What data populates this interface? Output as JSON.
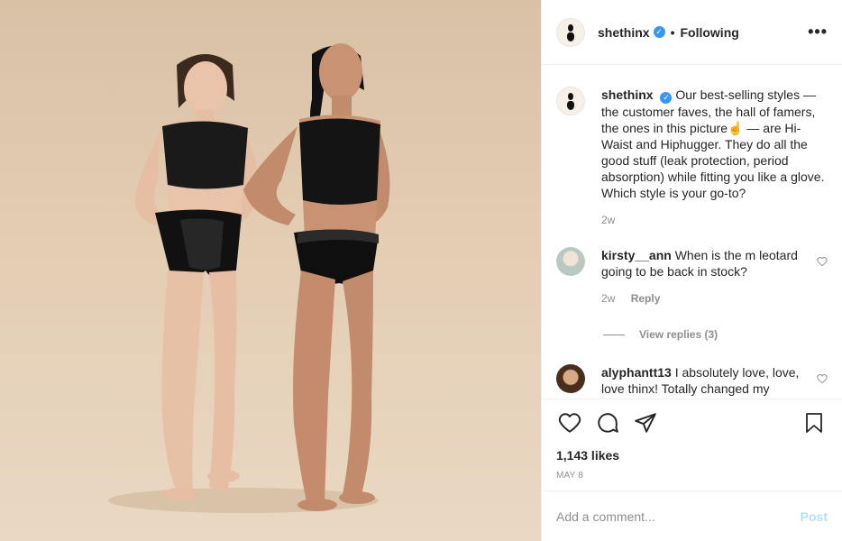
{
  "post": {
    "username": "shethinx",
    "separator": "•",
    "following_label": "Following",
    "more_label": "•••",
    "verified_glyph": "✓"
  },
  "caption": {
    "username": "shethinx",
    "text": "Our best-selling styles — the customer faves, the hall of famers, the ones in this picture☝️ — are Hi-Waist and Hiphugger. They do all the good stuff (leak protection, period absorption) while fitting you like a glove. Which style is your go-to?",
    "time": "2w"
  },
  "comments": [
    {
      "username": "kirsty__ann",
      "text": "When is the m leotard going to be back in stock?",
      "time": "2w",
      "reply_label": "Reply",
      "view_replies": "View replies (3)"
    },
    {
      "username": "alyphantt13",
      "text": "I absolutely love, love, love thinx! Totally changed my"
    }
  ],
  "icons": {
    "like": "heart-icon",
    "comment": "comment-icon",
    "share": "share-icon",
    "save": "bookmark-icon",
    "comment_like": "heart-icon"
  },
  "likes": "1,143 likes",
  "date": "MAY 8",
  "add_comment": {
    "placeholder": "Add a comment...",
    "post_label": "Post"
  },
  "colors": {
    "verified": "#3897f0",
    "post_disabled": "#b2dffc",
    "muted": "#8e8e8e",
    "photo_background": "#e3cdb3"
  }
}
